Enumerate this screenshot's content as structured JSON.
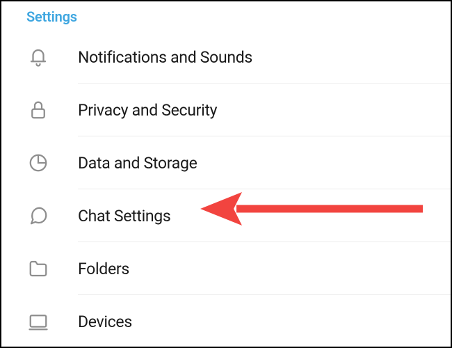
{
  "header": {
    "title": "Settings"
  },
  "items": [
    {
      "id": "notifications",
      "icon": "bell-icon",
      "label": "Notifications and Sounds"
    },
    {
      "id": "privacy",
      "icon": "lock-icon",
      "label": "Privacy and Security"
    },
    {
      "id": "data",
      "icon": "pie-icon",
      "label": "Data and Storage"
    },
    {
      "id": "chat",
      "icon": "chat-icon",
      "label": "Chat Settings"
    },
    {
      "id": "folders",
      "icon": "folder-icon",
      "label": "Folders"
    },
    {
      "id": "devices",
      "icon": "device-icon",
      "label": "Devices"
    }
  ],
  "annotation": {
    "points_to": "chat",
    "color": "#f2443f"
  }
}
